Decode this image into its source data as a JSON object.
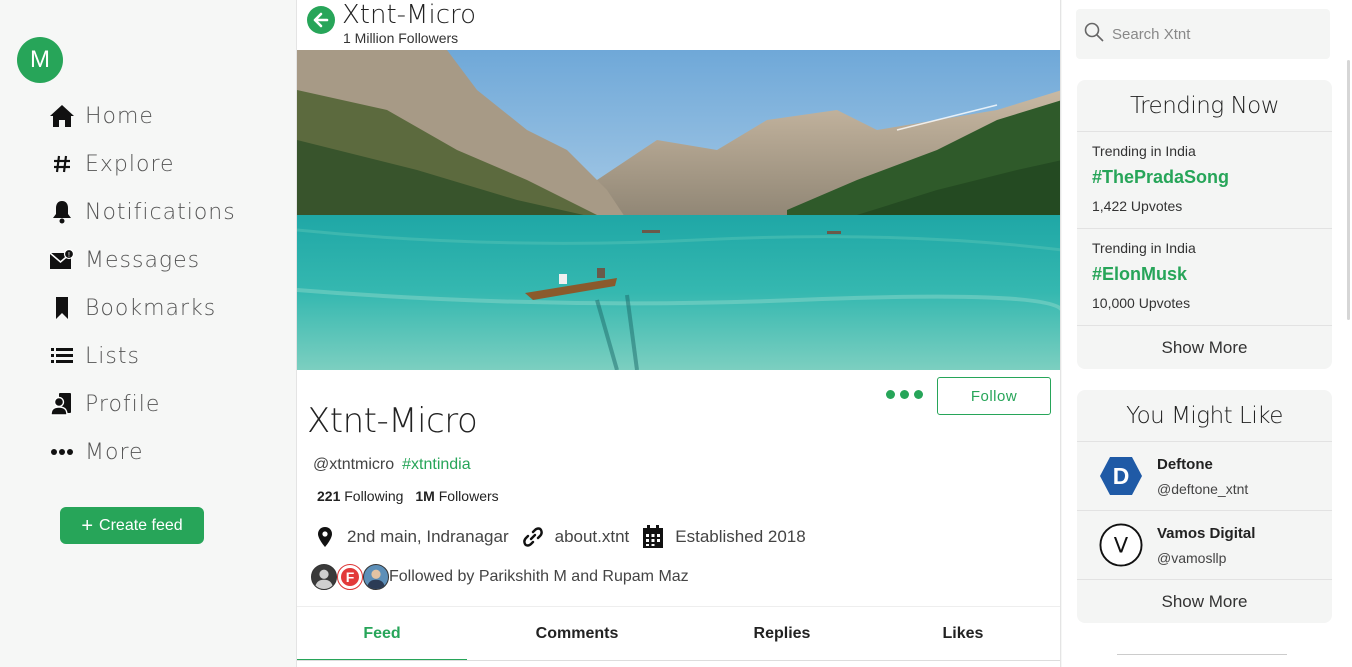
{
  "sidebar": {
    "avatar_letter": "M",
    "items": [
      {
        "label": "Home",
        "icon": "home-icon"
      },
      {
        "label": "Explore",
        "icon": "hash-icon"
      },
      {
        "label": "Notifications",
        "icon": "bell-icon"
      },
      {
        "label": "Messages",
        "icon": "envelope-icon"
      },
      {
        "label": "Bookmarks",
        "icon": "bookmark-icon"
      },
      {
        "label": "Lists",
        "icon": "list-icon"
      },
      {
        "label": "Profile",
        "icon": "profile-icon"
      },
      {
        "label": "More",
        "icon": "dots-icon"
      }
    ],
    "create_label": "Create feed"
  },
  "header": {
    "title": "Xtnt-Micro",
    "subtitle": "1 Million Followers"
  },
  "profile": {
    "name": "Xtnt-Micro",
    "handle": "@xtntmicro",
    "hashtag": "#xtntindia",
    "following_count": "221",
    "following_label": "Following",
    "followers_count": "1M",
    "followers_label": "Followers",
    "location": "2nd main, Indranagar",
    "website": "about.xtnt",
    "established": "Established 2018",
    "followed_by": "Followed by Parikshith M and Rupam Maz",
    "follow_label": "Follow",
    "mini_avatar_letter": "F"
  },
  "tabs": [
    {
      "label": "Feed",
      "active": true
    },
    {
      "label": "Comments",
      "active": false
    },
    {
      "label": "Replies",
      "active": false
    },
    {
      "label": "Likes",
      "active": false
    }
  ],
  "search": {
    "placeholder": "Search Xtnt"
  },
  "trending": {
    "title": "Trending Now",
    "items": [
      {
        "category": "Trending in India",
        "tag": "#ThePradaSong",
        "votes": "1,422 Upvotes"
      },
      {
        "category": "Trending in India",
        "tag": "#ElonMusk",
        "votes": "10,000 Upvotes"
      }
    ],
    "show_more": "Show More"
  },
  "suggestions": {
    "title": "You Might Like",
    "items": [
      {
        "name": "Deftone",
        "handle": "@deftone_xtnt",
        "avatar_letter": "D"
      },
      {
        "name": "Vamos Digital",
        "handle": "@vamosllp",
        "avatar_letter": "V"
      }
    ],
    "show_more": "Show More"
  },
  "colors": {
    "accent": "#27a559",
    "sidebar_bg": "#f6f7f6",
    "card_bg": "#f4f5f4",
    "deftone_blue": "#1f5aa6"
  }
}
